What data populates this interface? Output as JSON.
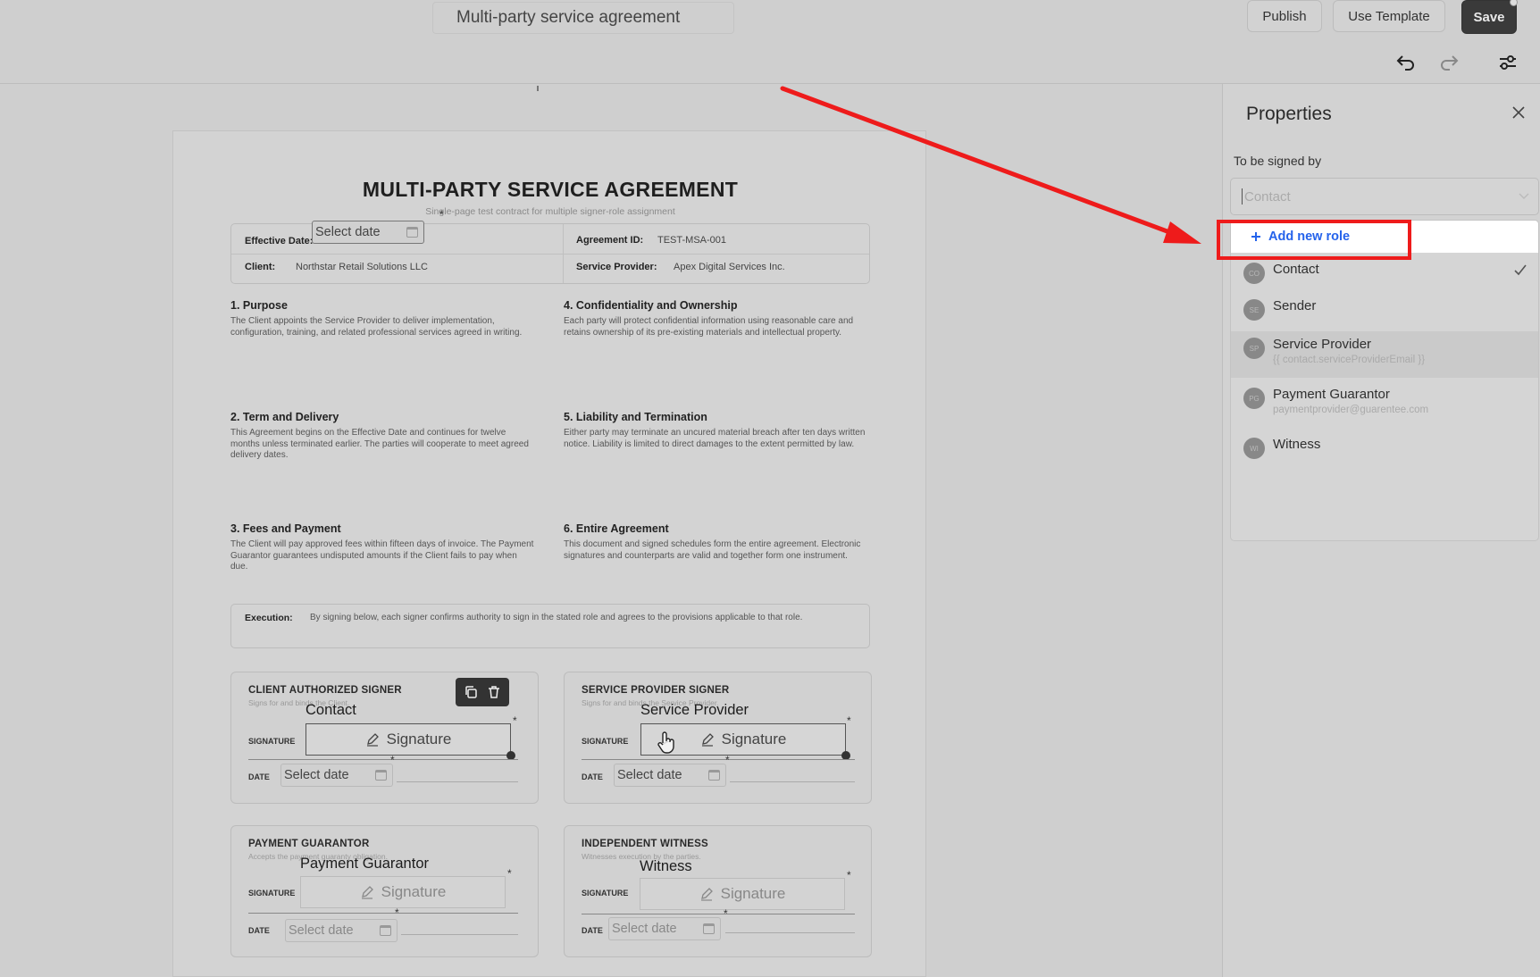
{
  "header": {
    "document_title": "Multi-party service agreement",
    "publish_label": "Publish",
    "use_template_label": "Use Template",
    "save_label": "Save"
  },
  "document": {
    "heading": "MULTI-PARTY SERVICE AGREEMENT",
    "subheading": "Single-page test contract for multiple signer-role assignment",
    "info": {
      "effective_date_label": "Effective Date:",
      "effective_date_placeholder": "Select date",
      "agreement_id_label": "Agreement ID:",
      "agreement_id_value": "TEST-MSA-001",
      "client_label": "Client:",
      "client_value": "Northstar Retail Solutions LLC",
      "provider_label": "Service Provider:",
      "provider_value": "Apex Digital Services Inc."
    },
    "sections": [
      {
        "title": "1. Purpose",
        "body": "The Client appoints the Service Provider to deliver implementation, configuration, training, and related professional services agreed in writing."
      },
      {
        "title": "4. Confidentiality and Ownership",
        "body": "Each party will protect confidential information using reasonable care and retains ownership of its pre-existing materials and intellectual property."
      },
      {
        "title": "2. Term and Delivery",
        "body": "This Agreement begins on the Effective Date and continues for twelve months unless terminated earlier. The parties will cooperate to meet agreed delivery dates."
      },
      {
        "title": "5. Liability and Termination",
        "body": "Either party may terminate an uncured material breach after ten days written notice. Liability is limited to direct damages to the extent permitted by law."
      },
      {
        "title": "3. Fees and Payment",
        "body": "The Client will pay approved fees within fifteen days of invoice. The Payment Guarantor guarantees undisputed amounts if the Client fails to pay when due."
      },
      {
        "title": "6. Entire Agreement",
        "body": "This document and signed schedules form the entire agreement. Electronic signatures and counterparts are valid and together form one instrument."
      }
    ],
    "execution": {
      "label": "Execution:",
      "text": "By signing below, each signer confirms authority to sign in the stated role and agrees to the provisions applicable to that role."
    },
    "cards": [
      {
        "title": "CLIENT AUTHORIZED SIGNER",
        "subtitle": "Signs for and binds the Client.",
        "role": "Contact",
        "signature_label": "SIGNATURE",
        "signature_text": "Signature",
        "date_label": "DATE",
        "date_placeholder": "Select date"
      },
      {
        "title": "SERVICE PROVIDER SIGNER",
        "subtitle": "Signs for and binds the Service Provider.",
        "role": "Service Provider",
        "signature_label": "SIGNATURE",
        "signature_text": "Signature",
        "date_label": "DATE",
        "date_placeholder": "Select date"
      },
      {
        "title": "PAYMENT GUARANTOR",
        "subtitle": "Accepts the payment guaranty obligation.",
        "role": "Payment Guarantor",
        "signature_label": "SIGNATURE",
        "signature_text": "Signature",
        "date_label": "DATE",
        "date_placeholder": "Select date"
      },
      {
        "title": "INDEPENDENT WITNESS",
        "subtitle": "Witnesses execution by the parties.",
        "role": "Witness",
        "signature_label": "SIGNATURE",
        "signature_text": "Signature",
        "date_label": "DATE",
        "date_placeholder": "Select date"
      }
    ],
    "required_marker": "*"
  },
  "properties": {
    "title": "Properties",
    "signed_by_label": "To be signed by",
    "contact_placeholder": "Contact",
    "add_role_label": "Add new role",
    "roles": [
      {
        "initials": "CO",
        "name": "Contact",
        "email": "",
        "selected": true
      },
      {
        "initials": "SE",
        "name": "Sender",
        "email": ""
      },
      {
        "initials": "SP",
        "name": "Service Provider",
        "email": "{{ contact.serviceProviderEmail }}"
      },
      {
        "initials": "PG",
        "name": "Payment Guarantor",
        "email": "paymentprovider@guarentee.com"
      },
      {
        "initials": "WI",
        "name": "Witness",
        "email": ""
      }
    ]
  },
  "colors": {
    "annotation_red": "#ee1b1b",
    "link_blue": "#2563eb",
    "save_button": "#3a3a3a"
  },
  "icons": [
    "undo-icon",
    "redo-icon",
    "settings-sliders-icon",
    "close-icon",
    "copy-icon",
    "trash-icon",
    "pen-icon",
    "calendar-icon",
    "plus-icon",
    "check-icon",
    "hand-cursor-icon"
  ]
}
